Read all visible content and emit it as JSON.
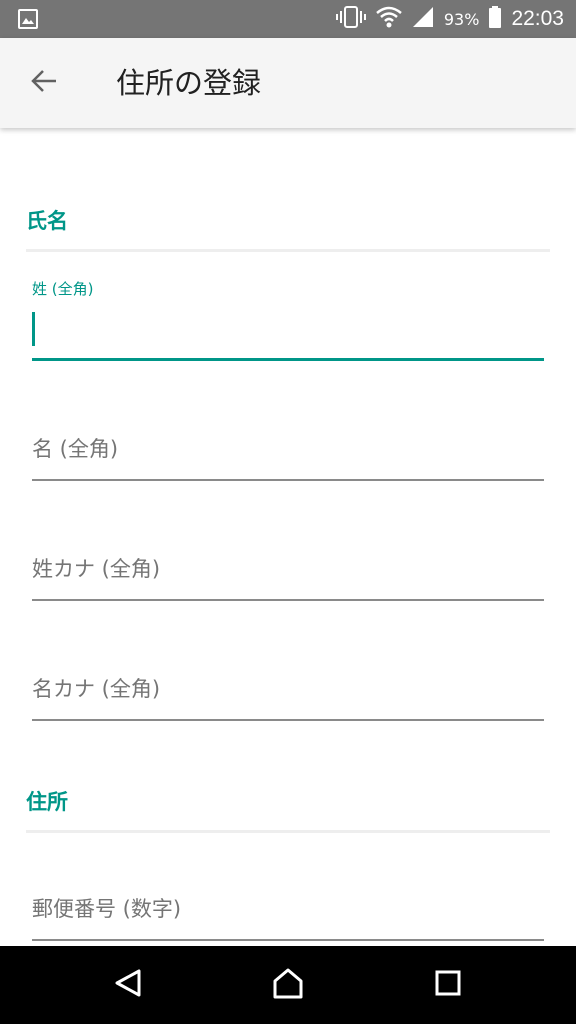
{
  "status_bar": {
    "battery_percent": "93%",
    "time": "22:03",
    "icons": [
      "image-icon",
      "vibrate-icon",
      "wifi-icon",
      "signal-icon",
      "battery-icon"
    ]
  },
  "app_bar": {
    "title": "住所の登録",
    "back_icon": "arrow-left-icon"
  },
  "form": {
    "name_section": {
      "header": "氏名",
      "last_name": {
        "label": "姓 (全角)",
        "value": ""
      },
      "first_name": {
        "placeholder": "名 (全角)"
      },
      "last_name_kana": {
        "placeholder": "姓カナ (全角)"
      },
      "first_name_kana": {
        "placeholder": "名カナ (全角)"
      }
    },
    "address_section": {
      "header": "住所",
      "postal_code": {
        "placeholder": "郵便番号 (数字)"
      }
    }
  },
  "nav_bar": {
    "icons": [
      "back-triangle-icon",
      "home-icon",
      "recents-square-icon"
    ]
  },
  "colors": {
    "accent": "#009688",
    "status_bar": "#757575",
    "app_bar": "#f5f5f5",
    "nav_bar": "#000000"
  }
}
